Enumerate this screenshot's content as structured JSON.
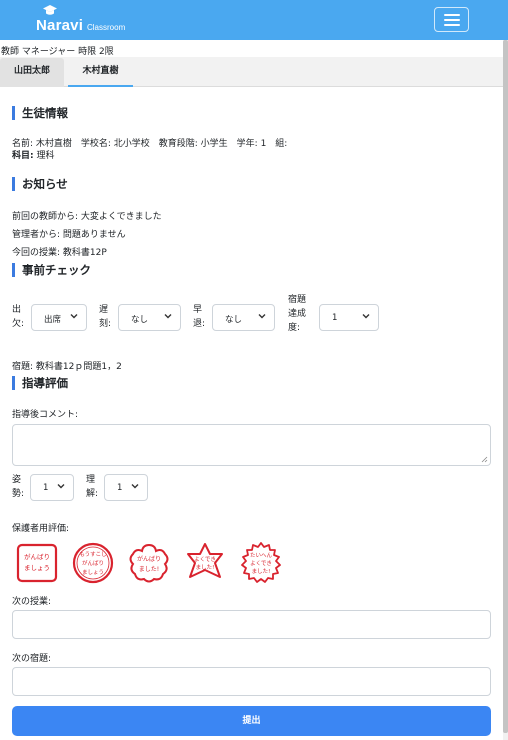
{
  "navbar": {
    "brand": "Naravi",
    "brand_sub": "Classroom"
  },
  "role_line": "教師 マネージャー 時限 2限",
  "tabs": [
    "山田太郎",
    "木村直樹"
  ],
  "student_info": {
    "title": "生徒情報",
    "line1": "名前: 木村直樹　学校名: 北小学校　教育段階: 小学生　学年: 1　組:",
    "line2_label": "科目:",
    "line2_value": " 理科"
  },
  "notices": {
    "title": "お知らせ",
    "items": [
      "前回の教師から: 大変よくできました",
      "管理者から: 問題ありません",
      "今回の授業: 教科書12P"
    ]
  },
  "precheck": {
    "title": "事前チェック",
    "attendance": {
      "label_a": "出",
      "label_b": "欠:",
      "value": "出席"
    },
    "late": {
      "label_a": "遅",
      "label_b": "刻:",
      "value": "なし"
    },
    "early": {
      "label_a": "早",
      "label_b": "退:",
      "value": "なし"
    },
    "homework_rate": {
      "label_a": "宿題",
      "label_b": "達成",
      "label_c": "度:",
      "value": "1"
    },
    "homework": "宿題: 教科書12ｐ問題1，2"
  },
  "evaluation": {
    "title": "指導評価",
    "comment_label": "指導後コメント:",
    "comment_value": "",
    "attitude": {
      "label_a": "姿",
      "label_b": "勢:",
      "value": "1"
    },
    "understanding": {
      "label_a": "理",
      "label_b": "解:",
      "value": "1"
    },
    "parent_label": "保護者用評価:",
    "stamps": [
      {
        "lines": [
          "がんばり",
          "ましょう"
        ],
        "shape": "square"
      },
      {
        "lines": [
          "もうすこし",
          "がんばり",
          "ましょう"
        ],
        "shape": "circle"
      },
      {
        "lines": [
          "がんばり",
          "ました!"
        ],
        "shape": "flower"
      },
      {
        "lines": [
          "よくでき",
          "ました!"
        ],
        "shape": "star"
      },
      {
        "lines": [
          "たいへん",
          "よくでき",
          "ました!"
        ],
        "shape": "burst"
      }
    ],
    "next_lesson_label": "次の授業:",
    "next_lesson_value": "",
    "next_homework_label": "次の宿題:",
    "next_homework_value": ""
  },
  "submit_label": "提出",
  "colors": {
    "navbar": "#4aa8f0",
    "accent": "#3b7be0",
    "submit": "#3b86f3",
    "stamp": "#d9232e"
  }
}
